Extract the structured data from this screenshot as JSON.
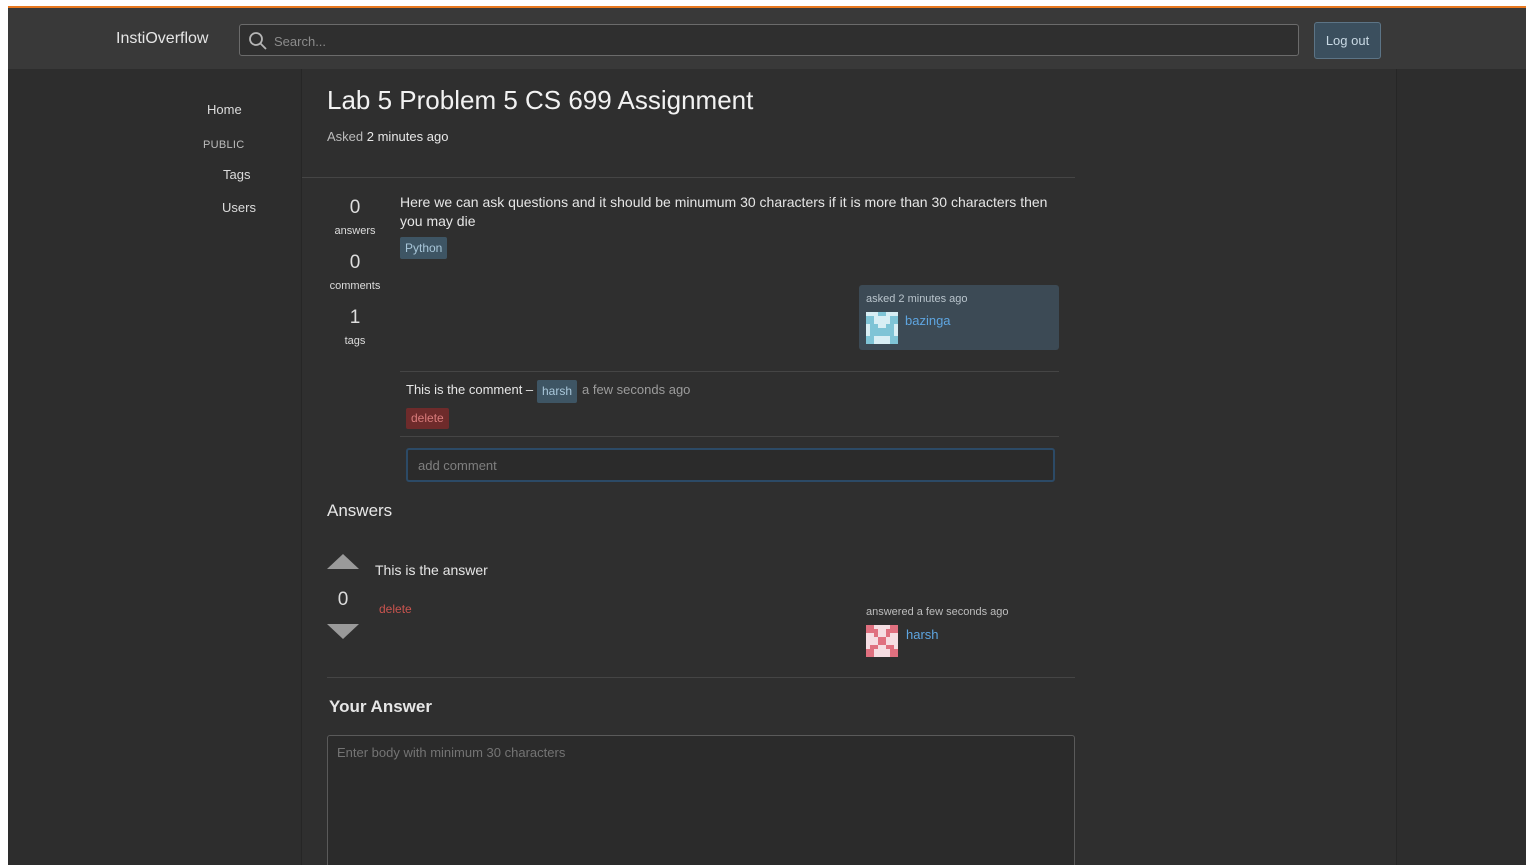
{
  "header": {
    "brand": "InstiOverflow",
    "search_placeholder": "Search...",
    "logout_label": "Log out"
  },
  "nav": {
    "home": "Home",
    "public_section": "PUBLIC",
    "tags": "Tags",
    "users": "Users"
  },
  "question": {
    "title": "Lab 5 Problem 5 CS 699 Assignment",
    "asked_prefix": "Asked",
    "asked_time": "2 minutes ago",
    "stats": [
      {
        "value": "0",
        "label": "answers"
      },
      {
        "value": "0",
        "label": "comments"
      },
      {
        "value": "1",
        "label": "tags"
      }
    ],
    "body": "Here we can ask questions and it should be minumum 30 characters if it is more than 30 characters then you may die",
    "tag": "Python",
    "owner": {
      "time_text": "asked 2 minutes ago",
      "username": "bazinga"
    }
  },
  "comments": [
    {
      "text": "This is the comment –",
      "user": "harsh",
      "time": "a few seconds ago",
      "delete_label": "delete"
    }
  ],
  "comment_input": {
    "placeholder": "add comment"
  },
  "answers_section": {
    "heading": "Answers",
    "answers": [
      {
        "votes": "0",
        "body": "This is the answer",
        "delete_label": "delete",
        "time_text": "answered a few seconds ago",
        "username": "harsh"
      }
    ]
  },
  "your_answer": {
    "heading": "Your Answer",
    "placeholder": "Enter body with minimum 30 characters"
  },
  "colors": {
    "accent_top_border": "#e8781f",
    "link_blue": "#5ea5e0",
    "delete_red": "#c9544f",
    "tag_bg": "#3e5564"
  },
  "icons": [
    "search-icon",
    "upvote-arrow-icon",
    "downvote-arrow-icon"
  ]
}
